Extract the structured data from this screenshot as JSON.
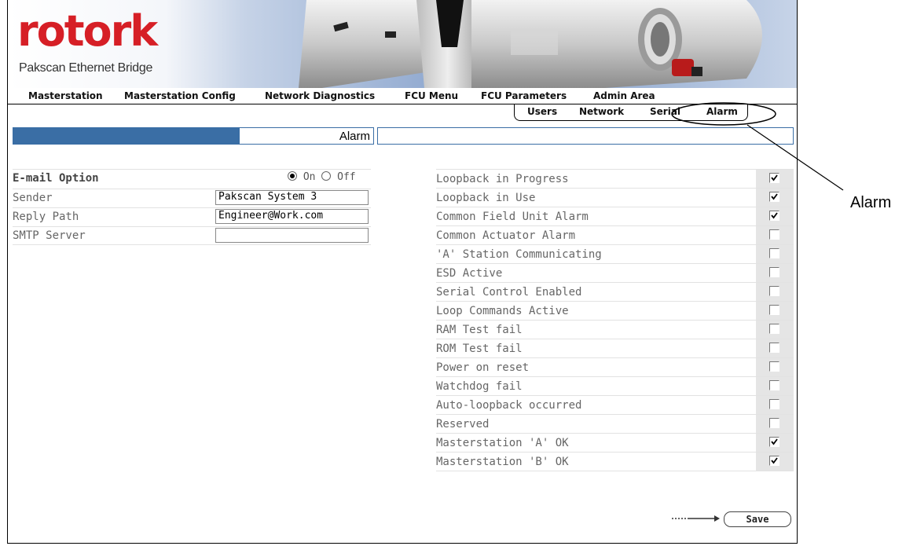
{
  "brand": {
    "logo_text": "rotork",
    "subtitle": "Pakscan Ethernet Bridge"
  },
  "menu": [
    {
      "label": "Masterstation"
    },
    {
      "label": "Masterstation Config"
    },
    {
      "label": "Network Diagnostics"
    },
    {
      "label": "FCU Menu"
    },
    {
      "label": "FCU Parameters"
    },
    {
      "label": "Admin Area"
    }
  ],
  "subtabs": [
    {
      "label": "Users"
    },
    {
      "label": "Network"
    },
    {
      "label": "Serial"
    },
    {
      "label": "Alarm",
      "active": true
    }
  ],
  "page_title": "Alarm",
  "email": {
    "option_label": "E-mail Option",
    "on_label": "On",
    "off_label": "Off",
    "selected": "On",
    "sender_label": "Sender",
    "sender_value": "Pakscan System 3",
    "reply_label": "Reply Path",
    "reply_value": "Engineer@Work.com",
    "smtp_label": "SMTP Server",
    "smtp_value": ""
  },
  "alarms": [
    {
      "label": "Loopback in Progress",
      "checked": true
    },
    {
      "label": "Loopback in Use",
      "checked": true
    },
    {
      "label": "Common Field Unit Alarm",
      "checked": true
    },
    {
      "label": "Common Actuator Alarm",
      "checked": false
    },
    {
      "label": "'A' Station Communicating",
      "checked": false
    },
    {
      "label": "ESD Active",
      "checked": false
    },
    {
      "label": "Serial Control Enabled",
      "checked": false
    },
    {
      "label": "Loop Commands Active",
      "checked": false
    },
    {
      "label": "RAM Test fail",
      "checked": false
    },
    {
      "label": "ROM Test fail",
      "checked": false
    },
    {
      "label": "Power on reset",
      "checked": false
    },
    {
      "label": "Watchdog fail",
      "checked": false
    },
    {
      "label": "Auto-loopback occurred",
      "checked": false
    },
    {
      "label": "Reserved",
      "checked": false
    },
    {
      "label": "Masterstation 'A' OK",
      "checked": true
    },
    {
      "label": "Masterstation 'B' OK",
      "checked": true
    }
  ],
  "save_label": "Save",
  "annotation": {
    "label": "Alarm"
  },
  "colors": {
    "brand_red": "#d61f26",
    "title_bar_blue": "#3a6ea5"
  }
}
